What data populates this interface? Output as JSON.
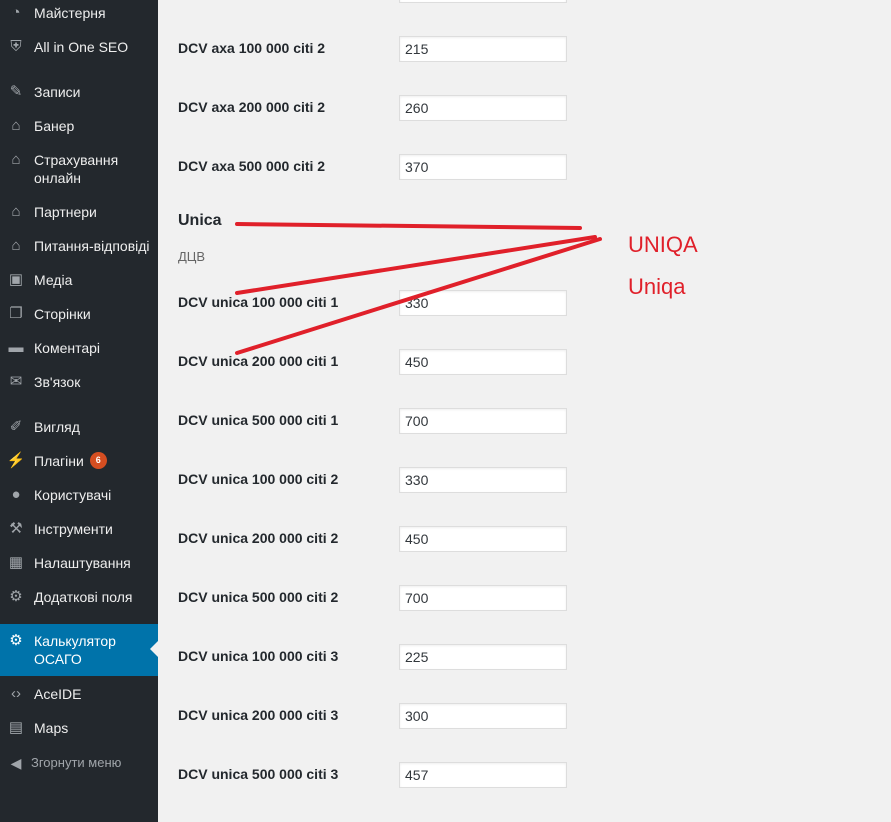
{
  "sidebar": {
    "items": [
      {
        "label": "Майстерня",
        "icon": "dashboard-icon"
      },
      {
        "label": "All in One SEO",
        "icon": "shield-icon"
      },
      {
        "label": "Записи",
        "icon": "pin-icon"
      },
      {
        "label": "Банер",
        "icon": "home-icon"
      },
      {
        "label": "Страхування онлайн",
        "icon": "home-icon"
      },
      {
        "label": "Партнери",
        "icon": "home-icon"
      },
      {
        "label": "Питання-відповіді",
        "icon": "home-icon"
      },
      {
        "label": "Медіа",
        "icon": "media-icon"
      },
      {
        "label": "Сторінки",
        "icon": "pages-icon"
      },
      {
        "label": "Коментарі",
        "icon": "comment-icon"
      },
      {
        "label": "Зв'язок",
        "icon": "mail-icon"
      },
      {
        "label": "Вигляд",
        "icon": "brush-icon"
      },
      {
        "label": "Плагіни",
        "icon": "plugin-icon",
        "badge": "6"
      },
      {
        "label": "Користувачі",
        "icon": "user-icon"
      },
      {
        "label": "Інструменти",
        "icon": "wrench-icon"
      },
      {
        "label": "Налаштування",
        "icon": "settings-icon"
      },
      {
        "label": "Додаткові поля",
        "icon": "gear-icon"
      },
      {
        "label": "Калькулятор ОСАГО",
        "icon": "gear-icon",
        "active": true
      },
      {
        "label": "AceIDE",
        "icon": "code-icon"
      },
      {
        "label": "Maps",
        "icon": "map-icon"
      }
    ],
    "collapse_label": "Згорнути меню"
  },
  "main": {
    "fields_top": [
      {
        "label": "DCV axa 100 000 citi 2",
        "value": "215"
      },
      {
        "label": "DCV axa 200 000 citi 2",
        "value": "260"
      },
      {
        "label": "DCV axa 500 000 citi 2",
        "value": "370"
      }
    ],
    "section_title": "Unica",
    "section_subtitle": "ДЦВ",
    "fields_unica": [
      {
        "label": "DCV unica 100 000 citi 1",
        "value": "330"
      },
      {
        "label": "DCV unica 200 000 citi 1",
        "value": "450"
      },
      {
        "label": "DCV unica 500 000 citi 1",
        "value": "700"
      },
      {
        "label": "DCV unica 100 000 citi 2",
        "value": "330"
      },
      {
        "label": "DCV unica 200 000 citi 2",
        "value": "450"
      },
      {
        "label": "DCV unica 500 000 citi 2",
        "value": "700"
      },
      {
        "label": "DCV unica 100 000 citi 3",
        "value": "225"
      },
      {
        "label": "DCV unica 200 000 citi 3",
        "value": "300"
      },
      {
        "label": "DCV unica 500 000 citi 3",
        "value": "457"
      }
    ]
  },
  "annotation": {
    "text1": "UNIQA",
    "text2": "Uniqa",
    "color": "#e0202a"
  },
  "colors": {
    "sidebar_bg": "#23282d",
    "active_bg": "#0073aa",
    "badge_bg": "#d54e21",
    "page_bg": "#f1f1f1"
  }
}
